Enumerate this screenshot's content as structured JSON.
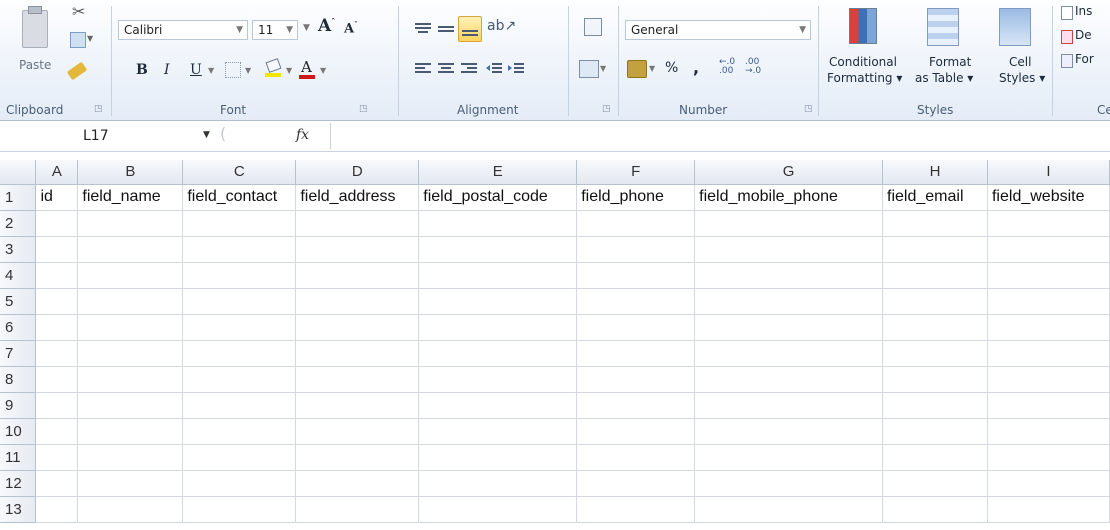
{
  "ribbon": {
    "clipboard": {
      "label": "Clipboard",
      "paste": "Paste"
    },
    "font": {
      "label": "Font",
      "name": "Calibri",
      "size": "11"
    },
    "alignment": {
      "label": "Alignment"
    },
    "number": {
      "label": "Number",
      "format": "General",
      "percent": "%",
      "comma": ","
    },
    "styles": {
      "label": "Styles",
      "conditional_1": "Conditional",
      "conditional_2": "Formatting ▾",
      "format_1": "Format",
      "format_2": "as Table ▾",
      "cell_1": "Cell",
      "cell_2": "Styles ▾"
    },
    "cells": {
      "label": "Ce",
      "insert": "Ins",
      "delete": "De",
      "format": "For"
    }
  },
  "formula_bar": {
    "cell_ref": "L17",
    "fx": "fx",
    "formula": ""
  },
  "sheet": {
    "columns": [
      "A",
      "B",
      "C",
      "D",
      "E",
      "F",
      "G",
      "H",
      "I"
    ],
    "row_numbers": [
      "1",
      "2",
      "3",
      "4",
      "5",
      "6",
      "7",
      "8",
      "9",
      "10",
      "11",
      "12",
      "13"
    ],
    "header_row": [
      "id",
      "field_name",
      "field_contact",
      "field_address",
      "field_postal_code",
      "field_phone",
      "field_mobile_phone",
      "field_email",
      "field_website"
    ]
  },
  "colors": {
    "ribbon_bg": "#e4ecf7",
    "grid_line": "#d4d9df",
    "header_bg": "#e3e9f1"
  }
}
